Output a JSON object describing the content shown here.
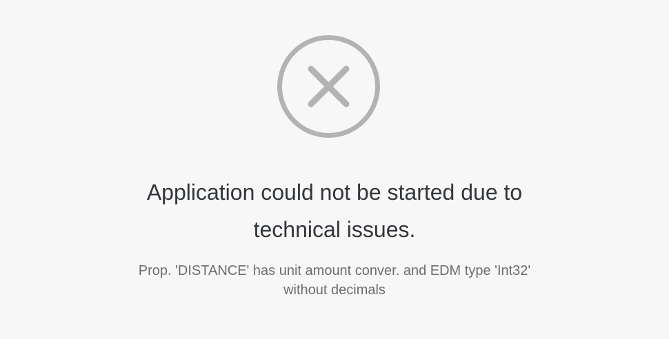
{
  "error": {
    "icon": "error-circle-x-icon",
    "icon_color": "#b3b3b3",
    "title": "Application could not be started due to\ntechnical issues.",
    "description": "Prop. 'DISTANCE' has unit amount conver. and EDM type 'Int32'\nwithout decimals"
  },
  "colors": {
    "background": "#f7f7f7",
    "title_text": "#32363a",
    "description_text": "#6a6d70"
  }
}
